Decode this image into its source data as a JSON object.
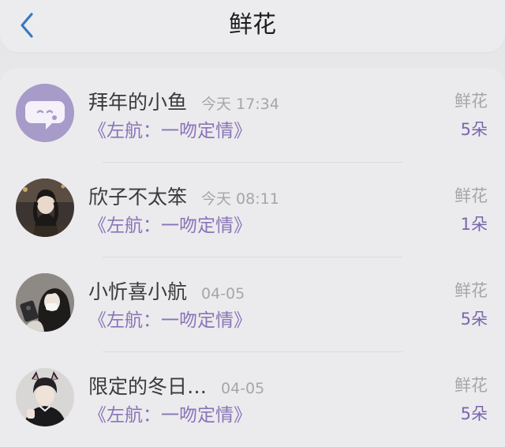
{
  "header": {
    "title": "鲜花",
    "back_icon": "chevron-left-icon",
    "accent_color": "#3a78c0"
  },
  "colors": {
    "gift_text": "#8a74b8",
    "count_text": "#7a66ad",
    "muted_text": "#a6a6aa"
  },
  "list": [
    {
      "name": "拜年的小鱼",
      "time": "今天 17:34",
      "gift": "《左航：一吻定情》",
      "type": "鲜花",
      "count": "5朵",
      "avatar": "chat-bubble-icon"
    },
    {
      "name": "欣子不太笨",
      "time": "今天 08:11",
      "gift": "《左航：一吻定情》",
      "type": "鲜花",
      "count": "1朵",
      "avatar": "user-photo"
    },
    {
      "name": "小忻喜小航",
      "time": "04-05",
      "gift": "《左航：一吻定情》",
      "type": "鲜花",
      "count": "5朵",
      "avatar": "user-photo"
    },
    {
      "name": "限定的冬日…",
      "time": "04-05",
      "gift": "《左航：一吻定情》",
      "type": "鲜花",
      "count": "5朵",
      "avatar": "user-photo"
    }
  ]
}
